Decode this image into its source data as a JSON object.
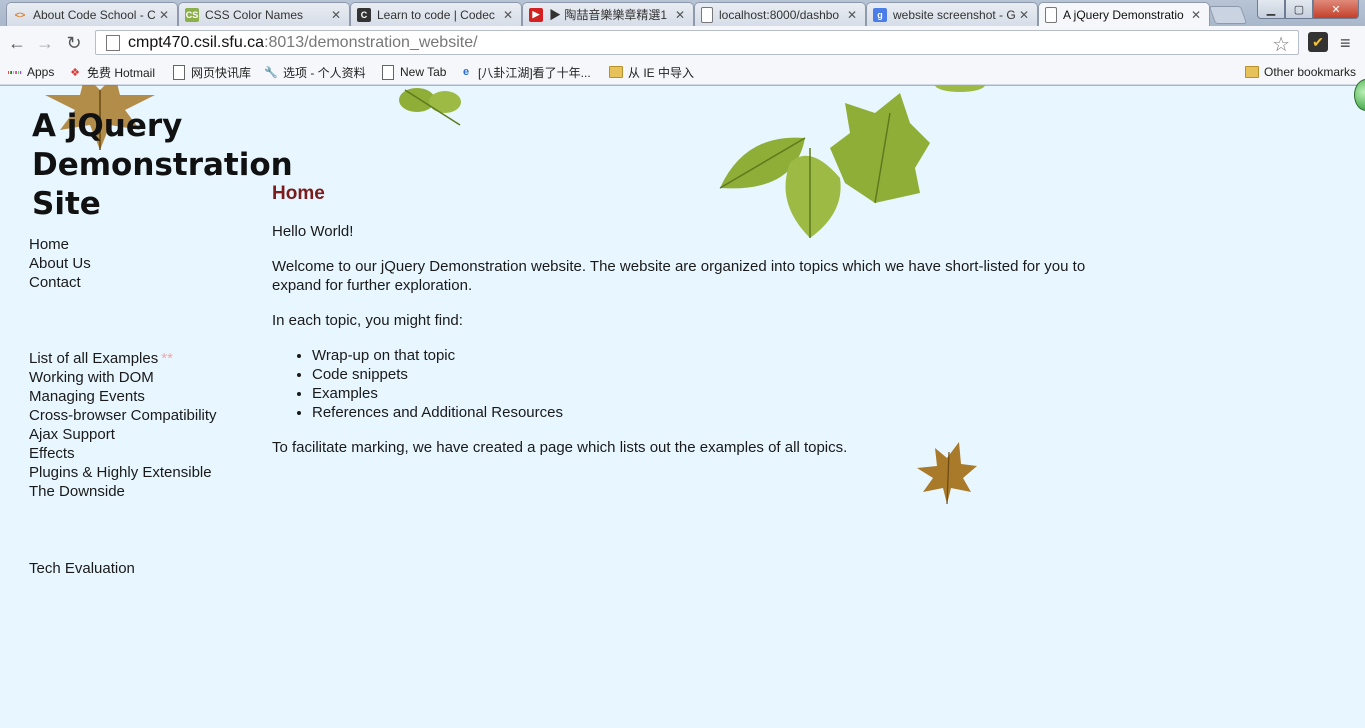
{
  "browser": {
    "tabs": [
      {
        "title": "About Code School - C",
        "favicon": "code-school-icon",
        "color": "#f0a050",
        "glyph": "<>"
      },
      {
        "title": "CSS Color Names",
        "favicon": "css-colors-icon",
        "color": "#8bb04a",
        "glyph": "CS"
      },
      {
        "title": "Learn to code | Codec",
        "favicon": "codecademy-icon",
        "color": "#333333",
        "glyph": "C"
      },
      {
        "title": "▶ 陶喆音樂樂章精選1",
        "favicon": "youtube-icon",
        "color": "#d32121",
        "glyph": "▶"
      },
      {
        "title": "localhost:8000/dashbo",
        "favicon": "page-icon",
        "color": "#ffffff",
        "glyph": ""
      },
      {
        "title": "website screenshot - G",
        "favicon": "google-icon",
        "color": "#4a7de8",
        "glyph": "g"
      },
      {
        "title": "A jQuery Demonstratio",
        "favicon": "page-icon",
        "color": "#ffffff",
        "glyph": "",
        "active": true
      }
    ],
    "address": {
      "host": "cmpt470.csil.sfu.ca",
      "path": ":8013/demonstration_website/"
    },
    "bookmarks": [
      {
        "label": "Apps",
        "icon": "apps-grid-icon"
      },
      {
        "label": "免费 Hotmail",
        "icon": "windows-icon"
      },
      {
        "label": "网页快讯库",
        "icon": "page-icon"
      },
      {
        "label": "选项 - 个人资料",
        "icon": "wrench-icon"
      },
      {
        "label": "New Tab",
        "icon": "page-icon"
      },
      {
        "label": "[八卦江湖]看了十年...",
        "icon": "ie-icon"
      },
      {
        "label": "从 IE 中导入",
        "icon": "folder-icon"
      }
    ],
    "other_bookmarks": "Other bookmarks",
    "colors": {
      "leaf_green": "#8fae38",
      "leaf_brown": "#a87a2a",
      "heading": "#7b1b1b",
      "page_bg": "#e8f7ff"
    }
  },
  "site": {
    "title": "A jQuery Demonstration Site",
    "nav_primary": [
      "Home",
      "About Us",
      "Contact"
    ],
    "nav_topics": [
      {
        "label": "List of all Examples",
        "badge": "**"
      },
      {
        "label": "Working with DOM"
      },
      {
        "label": "Managing Events"
      },
      {
        "label": "Cross-browser Compatibility"
      },
      {
        "label": "Ajax Support"
      },
      {
        "label": "Effects"
      },
      {
        "label": "Plugins & Highly Extensible"
      },
      {
        "label": "The Downside"
      }
    ],
    "nav_extra": [
      "Tech Evaluation"
    ]
  },
  "main": {
    "heading": "Home",
    "greeting": "Hello World!",
    "intro": "Welcome to our jQuery Demonstration website. The website are organized into topics which we have short-listed for you to expand for further exploration.",
    "list_intro": "In each topic, you might find:",
    "list": [
      "Wrap-up on that topic",
      "Code snippets",
      "Examples",
      "References and Additional Resources"
    ],
    "closing": "To facilitate marking, we have created a page which lists out the examples of all topics."
  }
}
